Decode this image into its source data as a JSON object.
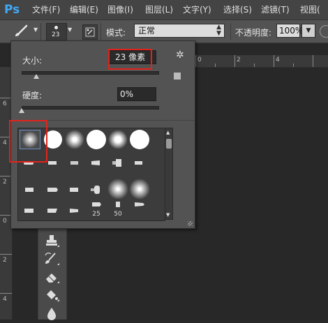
{
  "app_logo": "Ps",
  "menu": [
    "文件(F)",
    "编辑(E)",
    "图像(I)",
    "图层(L)",
    "文字(Y)",
    "选择(S)",
    "滤镜(T)",
    "视图("
  ],
  "options_bar": {
    "brush_size_preview": "23",
    "mode_label": "模式:",
    "mode_value": "正常",
    "opacity_label": "不透明度:",
    "opacity_value": "100%"
  },
  "brush_picker": {
    "size_label": "大小:",
    "size_value": "23 像素",
    "hardness_label": "硬度:",
    "hardness_value": "0%",
    "size_slider_value": 0.09,
    "hardness_slider_value": 0.0,
    "preset_labels": [
      "25",
      "50"
    ]
  },
  "rulers": {
    "top_labels": [
      "0",
      "2",
      "4"
    ],
    "left_labels": [
      "6",
      "4",
      "2",
      "0",
      "2",
      "4"
    ]
  },
  "colors": {
    "annotation": "#e2221b",
    "ps_blue": "#3fa9f5",
    "panel_bg": "#535353"
  },
  "icons": [
    "brush-icon",
    "toggle-brush-panel-icon",
    "gear-icon",
    "new-preset-icon",
    "clone-stamp-icon",
    "history-brush-icon",
    "eraser-icon",
    "paint-bucket-icon",
    "blur-icon"
  ]
}
